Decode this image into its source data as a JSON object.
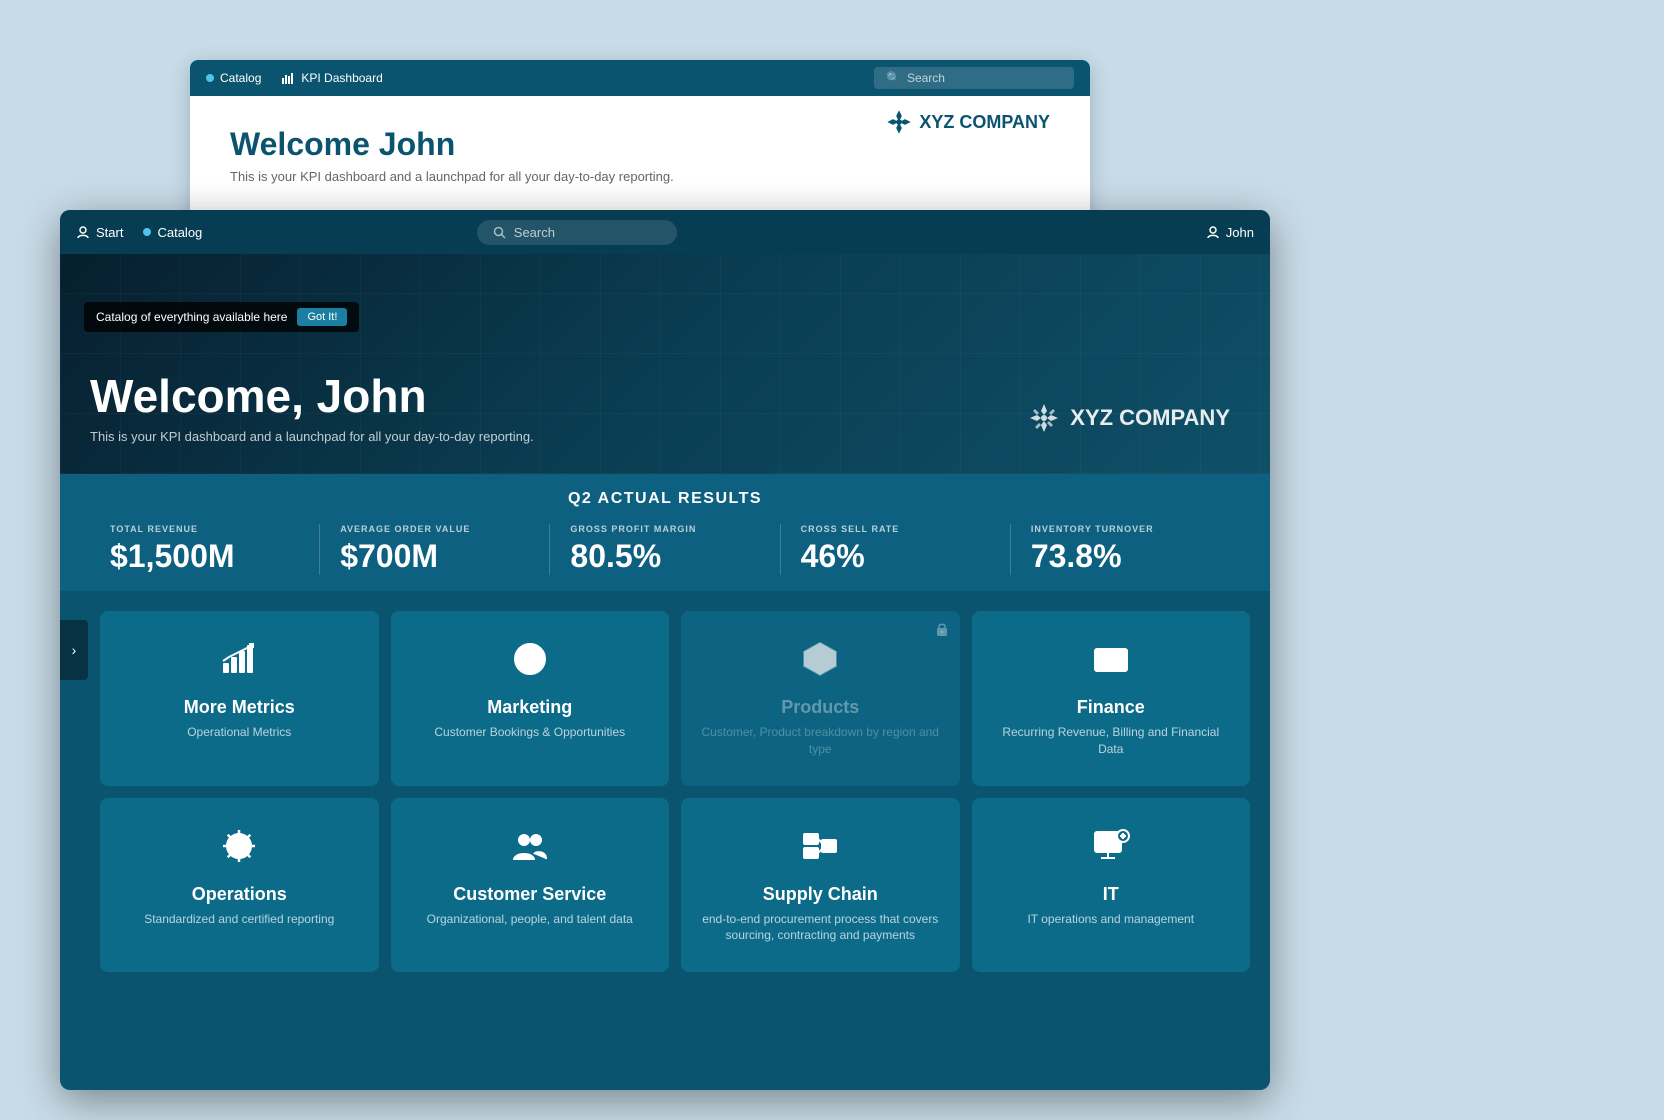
{
  "bgWindow": {
    "tabs": [
      {
        "label": "Catalog",
        "dot": true
      },
      {
        "label": "KPI Dashboard",
        "icon": "chart"
      }
    ],
    "search": {
      "placeholder": "Search"
    },
    "welcome": {
      "title": "Welcome John",
      "subtitle": "This is your KPI dashboard and a  launchpad for all your day-to-day reporting."
    },
    "logo": "XYZ COMPANY"
  },
  "mainWindow": {
    "nav": {
      "start": "Start",
      "catalog": "Catalog",
      "search": {
        "placeholder": "Search"
      },
      "user": "John"
    },
    "tooltip": {
      "text": "Catalog of everything available here",
      "button": "Got It!"
    },
    "hero": {
      "title": "Welcome, John",
      "subtitle": "This is your KPI dashboard and a  launchpad for all your day-to-day reporting.",
      "logo": "XYZ COMPANY"
    },
    "metricsBar": {
      "title": "Q2 ACTUAL RESULTS",
      "metrics": [
        {
          "label": "TOTAL REVENUE",
          "value": "$1,500M"
        },
        {
          "label": "AVERAGE ORDER VALUE",
          "value": "$700M"
        },
        {
          "label": "GROSS PROFIT MARGIN",
          "value": "80.5%"
        },
        {
          "label": "CROSS SELL RATE",
          "value": "46%"
        },
        {
          "label": "INVENTORY TURNOVER",
          "value": "73.8%"
        }
      ]
    },
    "cards": [
      {
        "title": "More Metrics",
        "subtitle": "Operational Metrics",
        "icon": "chart-up",
        "locked": false
      },
      {
        "title": "Marketing",
        "subtitle": "Customer Bookings & Opportunities",
        "icon": "globe",
        "locked": false
      },
      {
        "title": "Products",
        "subtitle": "Customer, Product breakdown by region and type",
        "icon": "box",
        "locked": true
      },
      {
        "title": "Finance",
        "subtitle": "Recurring Revenue, Billing and Financial Data",
        "icon": "money",
        "locked": false
      },
      {
        "title": "Operations",
        "subtitle": "Standardized and certified reporting",
        "icon": "gear",
        "locked": false
      },
      {
        "title": "Customer Service",
        "subtitle": "Organizational, people, and talent data",
        "icon": "people",
        "locked": false
      },
      {
        "title": "Supply Chain",
        "subtitle": "end-to-end procurement process that covers sourcing, contracting and payments",
        "icon": "supply",
        "locked": false
      },
      {
        "title": "IT",
        "subtitle": "IT operations and management",
        "icon": "computer",
        "locked": false
      }
    ]
  }
}
